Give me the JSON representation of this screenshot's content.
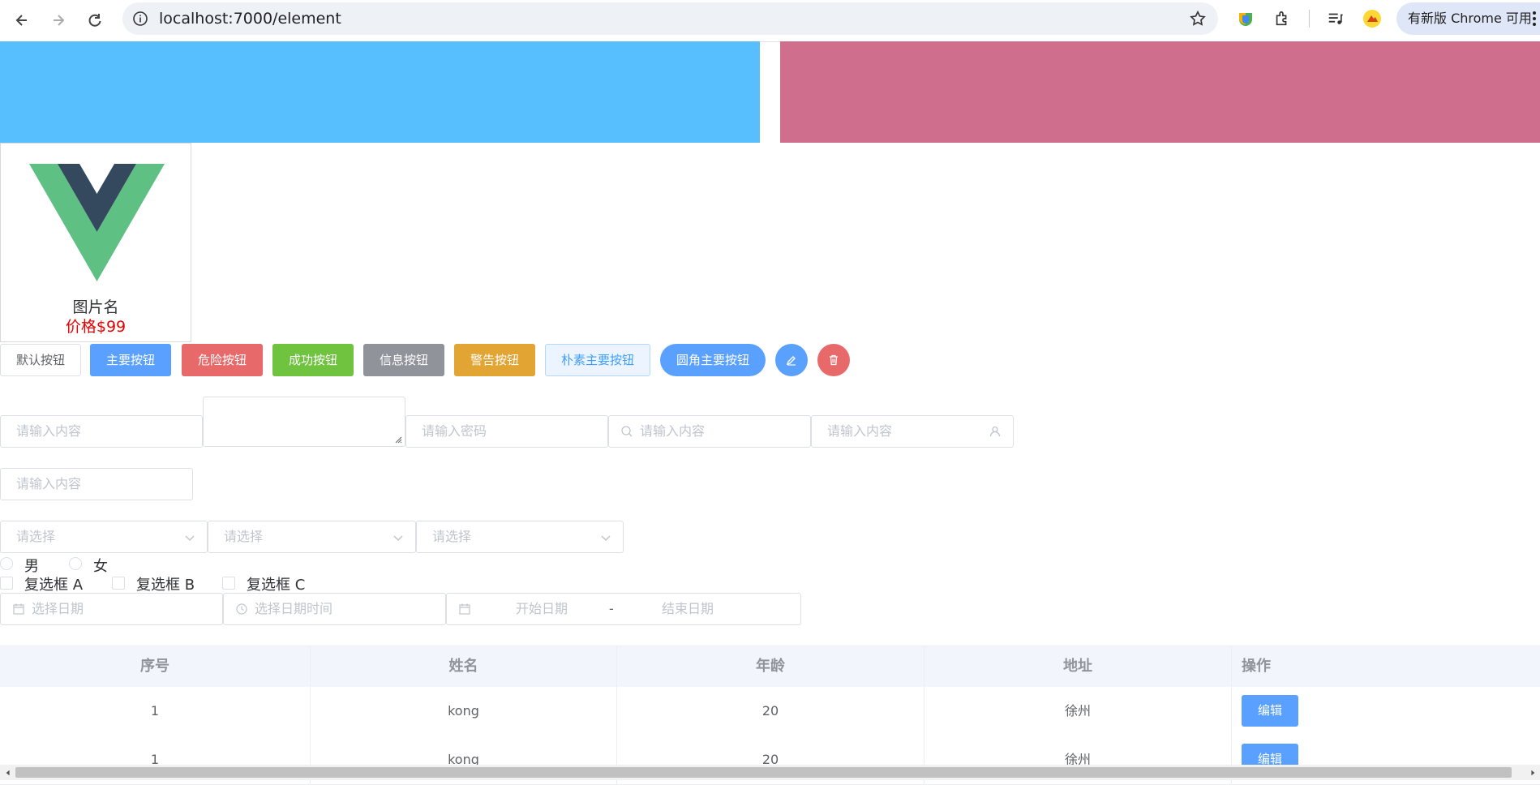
{
  "browser": {
    "url": "localhost:7000/element",
    "update_label": "有新版 Chrome 可用"
  },
  "card": {
    "name": "图片名",
    "price": "价格$99"
  },
  "buttons": {
    "default": "默认按钮",
    "primary": "主要按钮",
    "danger": "危险按钮",
    "success": "成功按钮",
    "info": "信息按钮",
    "warning": "警告按钮",
    "plain": "朴素主要按钮",
    "round": "圆角主要按钮"
  },
  "inputs": {
    "text_placeholder": "请输入内容",
    "password_placeholder": "请输入密码",
    "search_placeholder": "请输入内容",
    "user_placeholder": "请输入内容",
    "second_placeholder": "请输入内容"
  },
  "selects": [
    {
      "placeholder": "请选择"
    },
    {
      "placeholder": "请选择"
    },
    {
      "placeholder": "请选择"
    }
  ],
  "radios": [
    "男",
    "女"
  ],
  "checkboxes": [
    "复选框 A",
    "复选框 B",
    "复选框 C"
  ],
  "dates": {
    "date_placeholder": "选择日期",
    "datetime_placeholder": "选择日期时间",
    "range_start": "开始日期",
    "range_sep": "-",
    "range_end": "结束日期"
  },
  "table": {
    "headers": [
      "序号",
      "姓名",
      "年龄",
      "地址",
      "操作"
    ],
    "rows": [
      {
        "id": "1",
        "name": "kong",
        "age": "20",
        "address": "徐州",
        "action": "编辑"
      },
      {
        "id": "1",
        "name": "kong",
        "age": "20",
        "address": "徐州",
        "action": "编辑"
      }
    ]
  },
  "colors": {
    "blue_block": "#58bfff",
    "pink_block": "#d06e8d",
    "primary": "#5aa0ff",
    "danger": "#e86969",
    "success": "#6fc33e",
    "info": "#909399",
    "warning": "#e2a433",
    "price": "#e60000"
  }
}
